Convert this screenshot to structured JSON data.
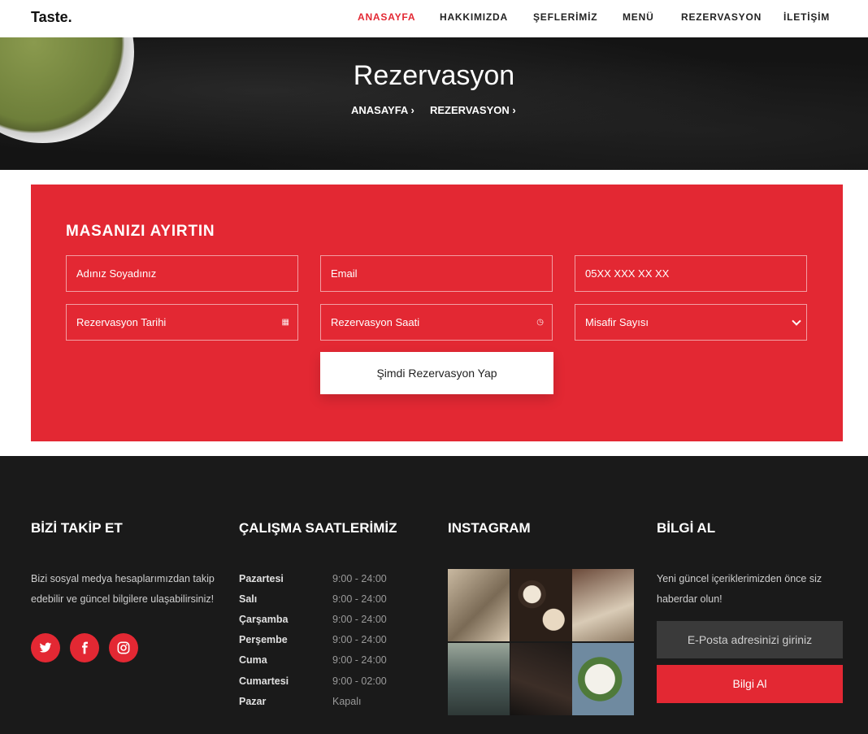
{
  "header": {
    "logo": "Taste.",
    "nav": [
      "ANASAYFA",
      "HAKKIMIZDA",
      "ŞEFLERİMİZ",
      "MENÜ",
      "REZERVASYON",
      "İLETİŞİM"
    ]
  },
  "hero": {
    "title": "Rezervasyon",
    "breadcrumb": [
      "ANASAYFA",
      "REZERVASYON"
    ]
  },
  "reservation": {
    "title": "MASANIZI AYIRTIN",
    "placeholders": {
      "name": "Adınız Soyadınız",
      "email": "Email",
      "phone": "05XX XXX XX XX",
      "date": "Rezervasyon Tarihi",
      "time": "Rezervasyon Saati",
      "guests": "Misafir Sayısı"
    },
    "submit": "Şimdi Rezervasyon Yap"
  },
  "footer": {
    "follow": {
      "title": "BİZİ TAKİP ET",
      "text_line1": "Bizi sosyal medya hesaplarımızdan takip",
      "text_line2": "edebilir ve güncel bilgilere ulaşabilirsiniz!",
      "icons": [
        "twitter-icon",
        "facebook-icon",
        "instagram-icon"
      ]
    },
    "hours": {
      "title": "ÇALIŞMA SAATLERİMİZ",
      "rows": [
        {
          "day": "Pazartesi",
          "time": "9:00 - 24:00"
        },
        {
          "day": "Salı",
          "time": "9:00 - 24:00"
        },
        {
          "day": "Çarşamba",
          "time": "9:00 - 24:00"
        },
        {
          "day": "Perşembe",
          "time": "9:00 - 24:00"
        },
        {
          "day": "Cuma",
          "time": "9:00 - 24:00"
        },
        {
          "day": "Cumartesi",
          "time": "9:00 - 02:00"
        },
        {
          "day": "Pazar",
          "time": "Kapalı"
        }
      ]
    },
    "instagram": {
      "title": "INSTAGRAM"
    },
    "newsletter": {
      "title": "BİLGİ AL",
      "text_line1": "Yeni güncel içeriklerimizden önce siz",
      "text_line2": "haberdar olun!",
      "placeholder": "E-Posta adresinizi giriniz",
      "button": "Bilgi Al"
    }
  },
  "colors": {
    "accent": "#e32833",
    "footer_bg": "#1a1a1a"
  }
}
